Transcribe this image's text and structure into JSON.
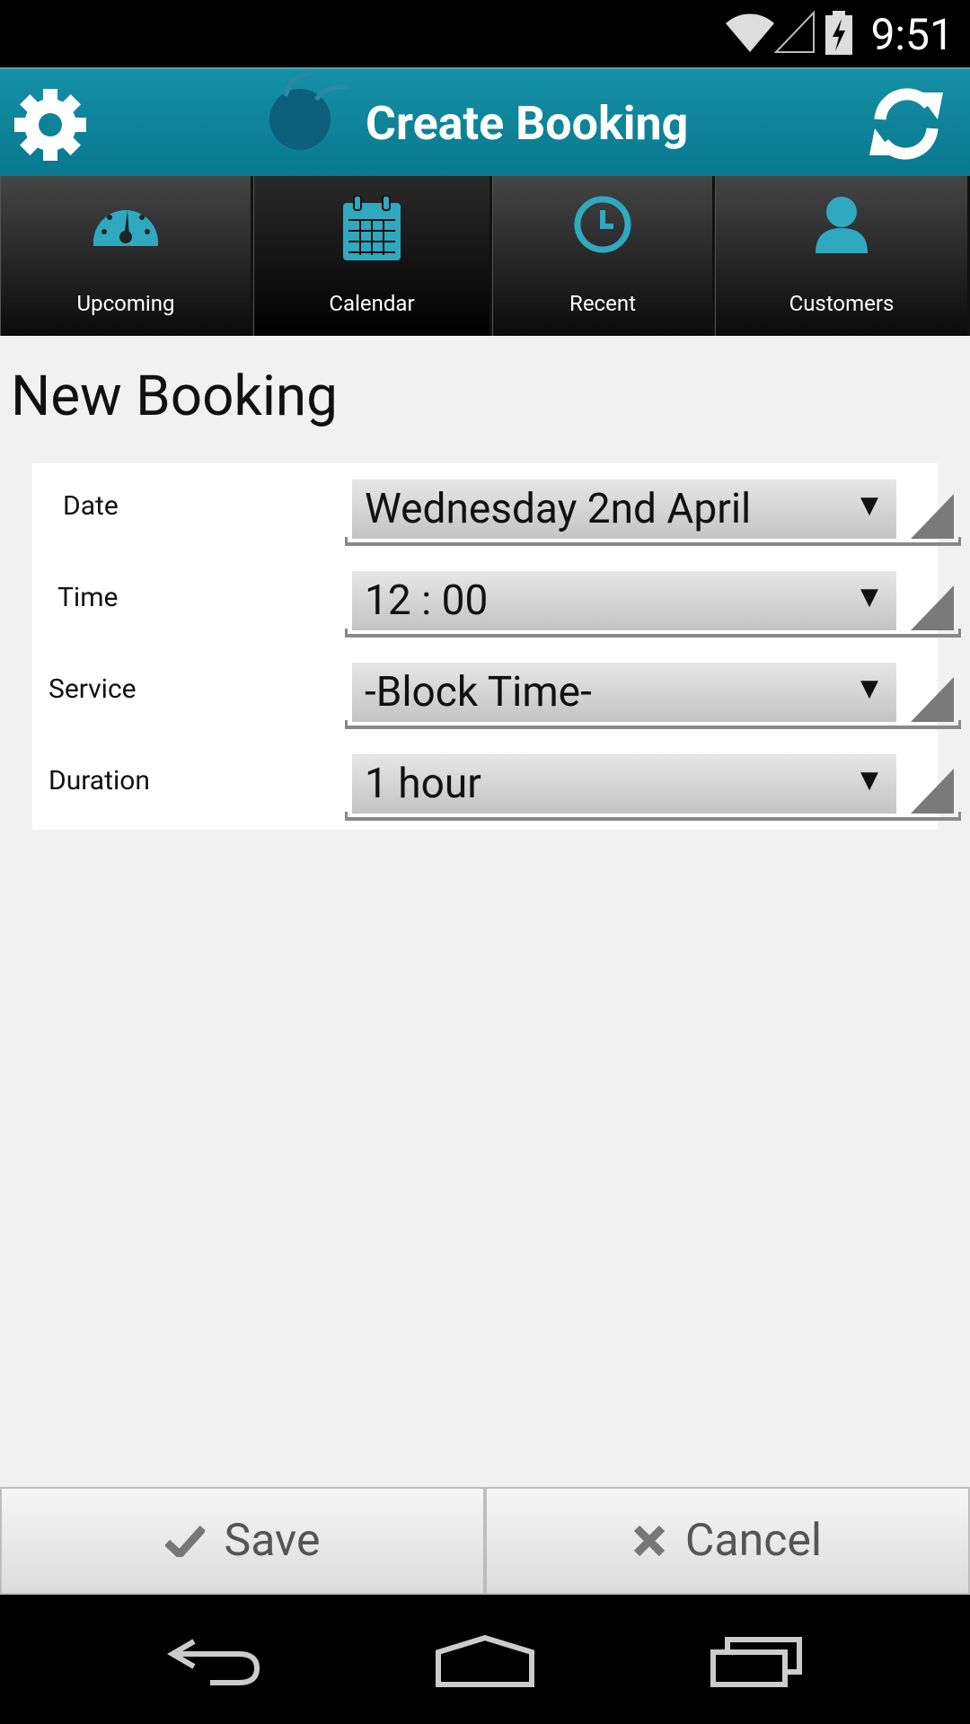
{
  "status_bar": {
    "time": "9:51"
  },
  "header": {
    "title": "Create Booking"
  },
  "tabs": [
    {
      "label": "Upcoming",
      "icon": "dashboard-icon"
    },
    {
      "label": "Calendar",
      "icon": "calendar-icon"
    },
    {
      "label": "Recent",
      "icon": "clock-icon"
    },
    {
      "label": "Customers",
      "icon": "person-icon"
    }
  ],
  "page_title": "New Booking",
  "form": {
    "fields": [
      {
        "label": "Date",
        "value": "Wednesday 2nd April"
      },
      {
        "label": "Time",
        "value": "12 : 00"
      },
      {
        "label": "Service",
        "value": "-Block Time-"
      },
      {
        "label": "Duration",
        "value": "1 hour"
      }
    ]
  },
  "actions": {
    "save_label": "Save",
    "cancel_label": "Cancel"
  },
  "colors": {
    "accent": "#1590a5",
    "icon": "#2fa9bf"
  }
}
